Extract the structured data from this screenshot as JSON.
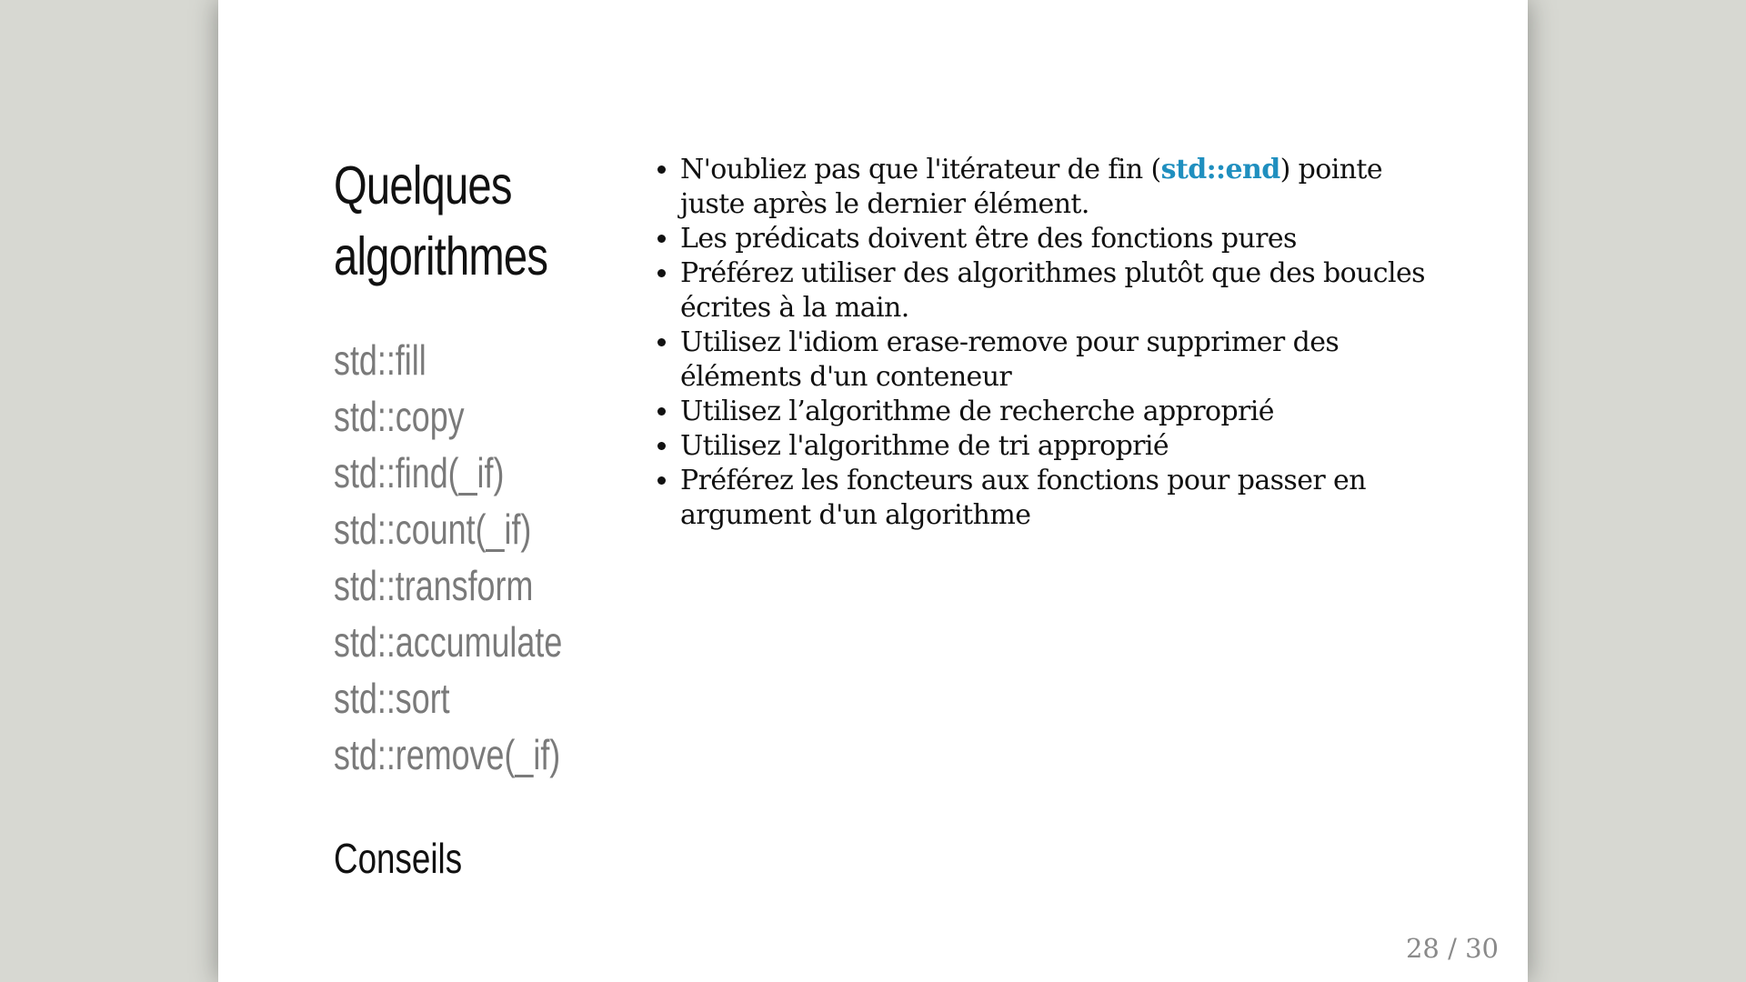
{
  "slide": {
    "title_line1": "Quelques",
    "title_line2": "algorithmes",
    "algorithms": [
      "std::fill",
      "std::copy",
      "std::find(_if)",
      "std::count(_if)",
      "std::transform",
      "std::accumulate",
      "std::sort",
      "std::remove(_if)"
    ],
    "subtitle": "Conseils",
    "tips": [
      {
        "before": "N'oubliez pas que l'itérateur de fin (",
        "code": "std::end",
        "after": ") pointe juste après le dernier élément."
      },
      {
        "text": "Les prédicats doivent être des fonctions pures"
      },
      {
        "text": "Préférez utiliser des algorithmes plutôt que des boucles écrites à la main."
      },
      {
        "text": "Utilisez l'idiom erase-remove pour supprimer des éléments d'un conteneur"
      },
      {
        "text": "Utilisez l’algorithme de recherche approprié"
      },
      {
        "text": "Utilisez l'algorithme de tri approprié"
      },
      {
        "text": "Préférez les foncteurs aux fonctions pour passer en argument d'un algorithme"
      }
    ],
    "page_number": "28 / 30"
  },
  "colors": {
    "background": "#d7d8d2",
    "slide": "#ffffff",
    "code_accent": "#1f8fbf",
    "muted_text": "#7a7a7a"
  }
}
